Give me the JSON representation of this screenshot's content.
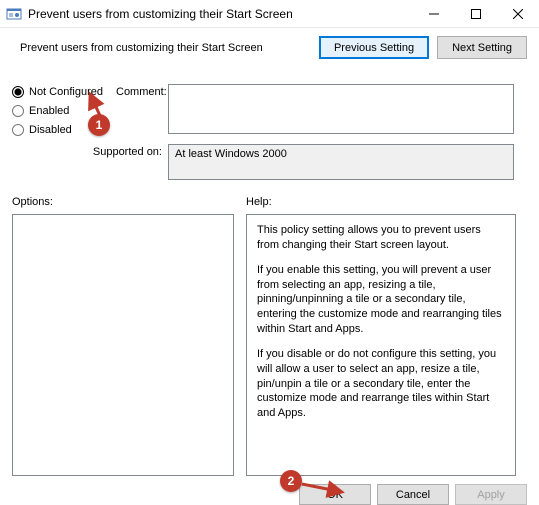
{
  "window": {
    "title": "Prevent users from customizing their Start Screen",
    "min_tip": "Minimize",
    "max_tip": "Maximize",
    "close_tip": "Close"
  },
  "header": {
    "subtitle": "Prevent users from customizing their Start Screen",
    "prev": "Previous Setting",
    "next": "Next Setting"
  },
  "radios": {
    "not_configured": "Not Configured",
    "enabled": "Enabled",
    "disabled": "Disabled"
  },
  "labels": {
    "comment": "Comment:",
    "supported": "Supported on:",
    "options": "Options:",
    "help": "Help:"
  },
  "fields": {
    "comment_value": "",
    "supported_value": "At least Windows 2000"
  },
  "help": {
    "p1": "This policy setting allows you to prevent users from changing their Start screen layout.",
    "p2": "If you enable this setting, you will prevent a user from selecting an app, resizing a tile, pinning/unpinning a tile or a secondary tile, entering the customize mode and rearranging tiles within Start and Apps.",
    "p3": "If you disable or do not configure this setting, you will allow a user to select an app, resize a tile, pin/unpin a tile or a secondary tile, enter the customize mode and rearrange tiles within Start and Apps."
  },
  "buttons": {
    "ok": "OK",
    "cancel": "Cancel",
    "apply": "Apply"
  },
  "annotations": {
    "c1": "1",
    "c2": "2"
  }
}
